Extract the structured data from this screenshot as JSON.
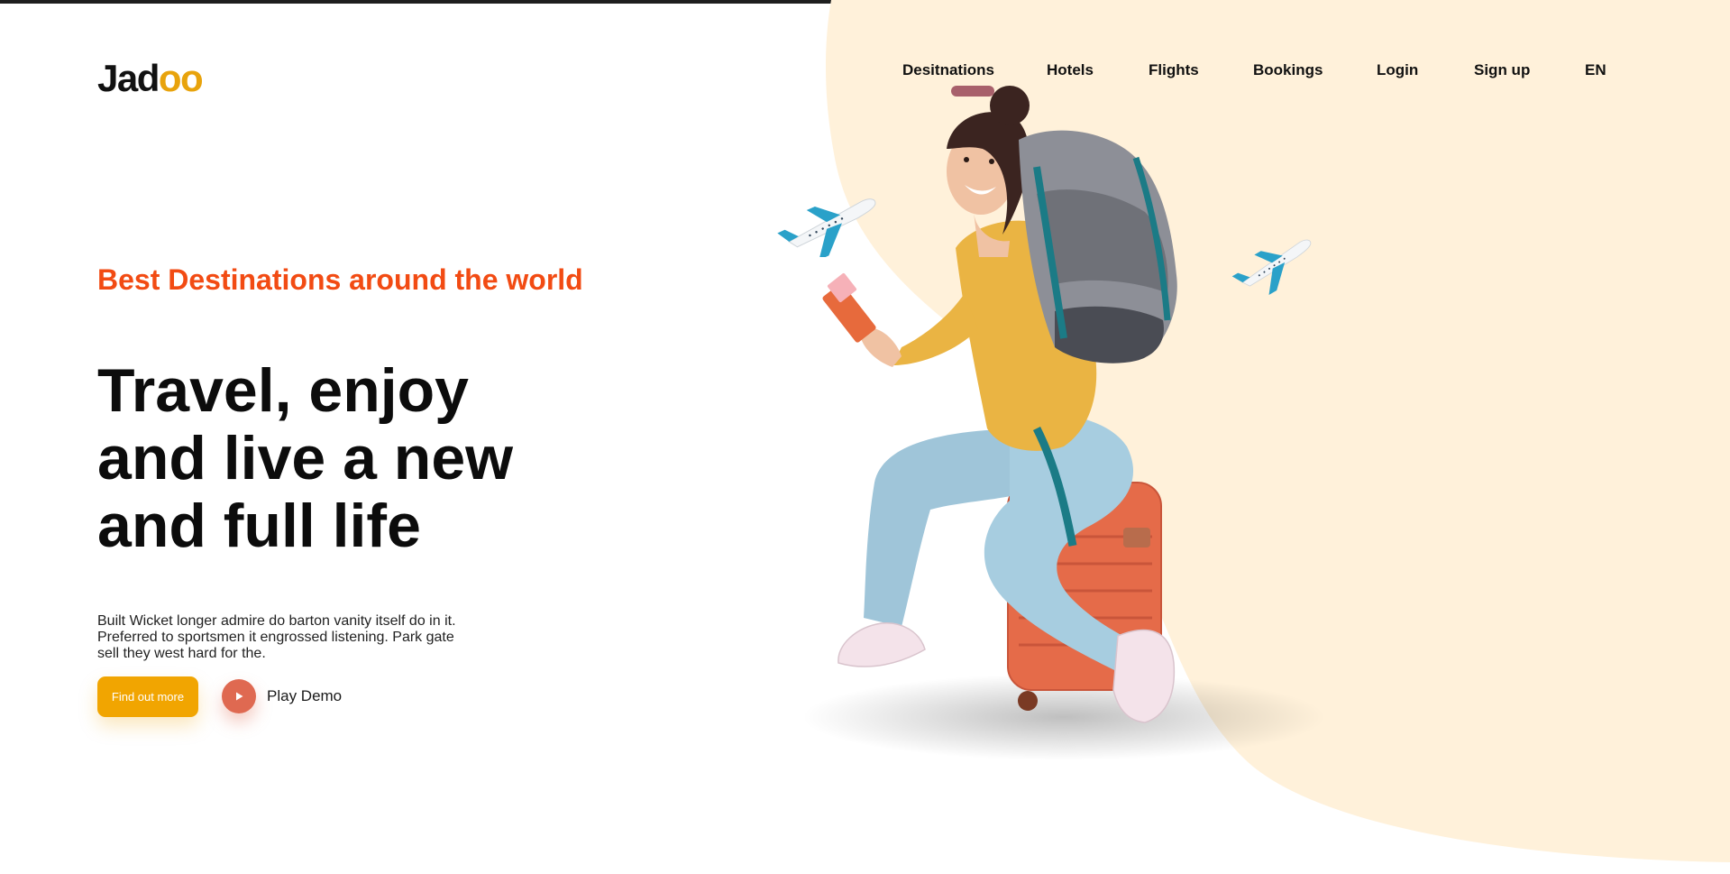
{
  "brand": {
    "logo_first": "Jad",
    "logo_rest": "oo"
  },
  "nav": {
    "items": [
      {
        "label": "Desitnations"
      },
      {
        "label": "Hotels"
      },
      {
        "label": "Flights"
      },
      {
        "label": "Bookings"
      },
      {
        "label": "Login"
      },
      {
        "label": "Sign up"
      },
      {
        "label": "EN"
      }
    ]
  },
  "hero": {
    "subtitle": "Best Destinations around the world",
    "headline": "Travel, enjoy and live a new and full life",
    "description": "Built Wicket longer admire do barton vanity itself do in it. Preferred to sportsmen it engrossed listening. Park gate sell they west hard for the.",
    "cta_label": "Find out more",
    "play_label": "Play Demo"
  },
  "illustration": {
    "subject": "traveler-sitting-on-suitcase",
    "icons": [
      "airplane-icon",
      "play-icon"
    ]
  },
  "colors": {
    "accent_orange": "#f24b13",
    "brand_yellow": "#f1a501",
    "play_red": "#df6951",
    "blob_cream": "#fff1da",
    "text_dark": "#111111"
  }
}
